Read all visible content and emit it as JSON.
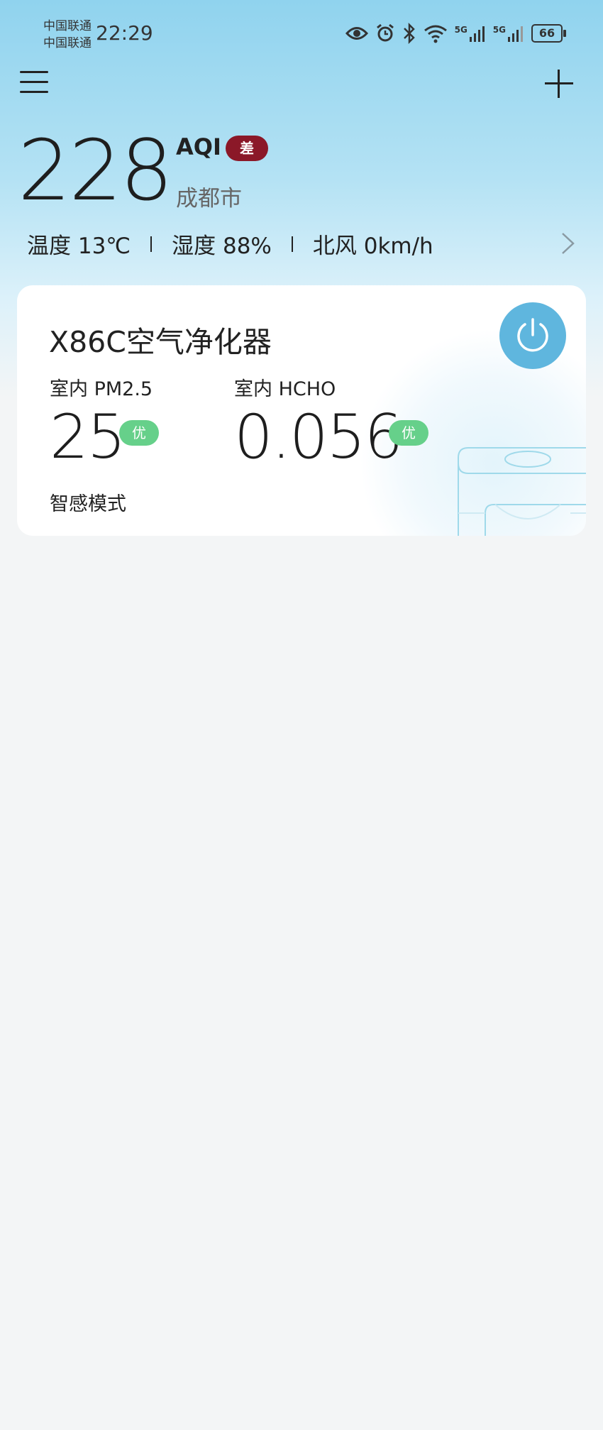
{
  "status_bar": {
    "carrier_1": "中国联通",
    "carrier_2": "中国联通",
    "time": "22:29",
    "signal_1": "5G",
    "signal_2": "5G",
    "battery": "66"
  },
  "header": {
    "menu_icon": "menu-icon",
    "add_icon": "plus-icon"
  },
  "air_quality": {
    "aqi_value": "228",
    "aqi_label": "AQI",
    "aqi_level": "差",
    "city": "成都市",
    "temperature": "温度 13℃",
    "humidity": "湿度 88%",
    "wind": "北风 0km/h",
    "badge_color": "#8b1828"
  },
  "device_card": {
    "name": "X86C空气净化器",
    "pm25_label": "室内 PM2.5",
    "pm25_value": "25",
    "pm25_level": "优",
    "hcho_label": "室内 HCHO",
    "hcho_value": "0.056",
    "hcho_level": "优",
    "mode": "智感模式",
    "power_color": "#5fb6de",
    "good_color": "#66d08a"
  }
}
